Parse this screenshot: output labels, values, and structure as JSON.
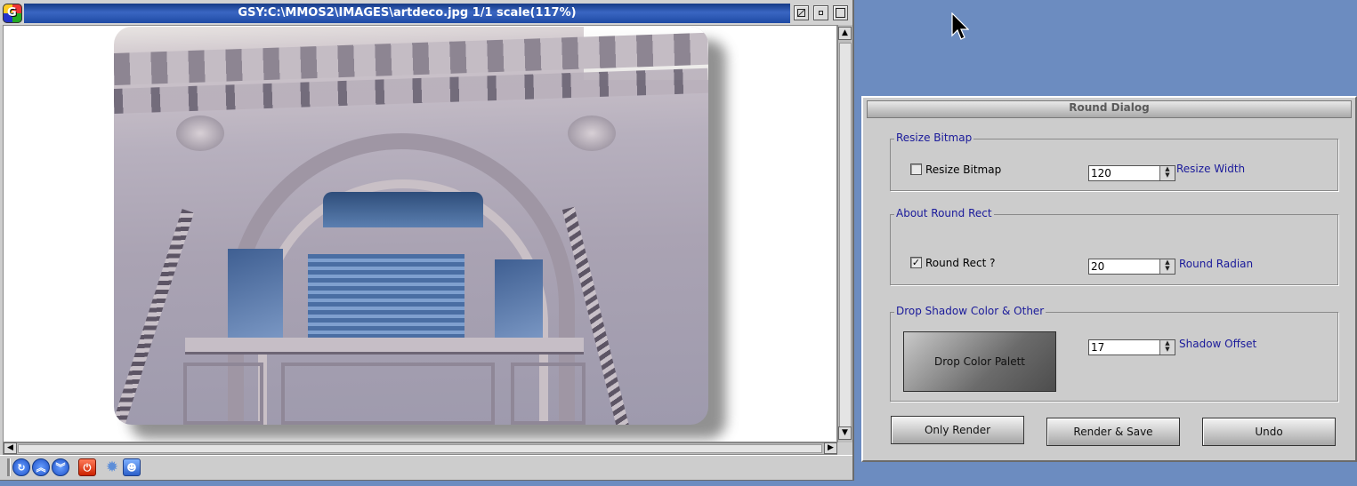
{
  "viewer": {
    "title": "GSY:C:\\MMOS2\\IMAGES\\artdeco.jpg   1/1 scale(117%)",
    "app_icon_letter": "G",
    "statusbar_icons": [
      "back-icon",
      "scroll-up-icon",
      "scroll-down-icon",
      "power-icon",
      "gear-icon",
      "agent-icon"
    ]
  },
  "dialog": {
    "title": "Round Dialog",
    "resize_group": {
      "label": "Resize Bitmap",
      "checkbox_label": "Resize Bitmap",
      "checked": false,
      "value": "120",
      "field_label": "Resize Width"
    },
    "round_group": {
      "label": "About Round Rect",
      "checkbox_label": "Round Rect ?",
      "checked": true,
      "value": "20",
      "field_label": "Round Radian"
    },
    "shadow_group": {
      "label": "Drop Shadow Color  & Other",
      "palette_label": "Drop Color Palett",
      "value": "17",
      "field_label": "Shadow Offset"
    },
    "buttons": {
      "only_render": "Only Render",
      "render_save": "Render & Save",
      "undo": "Undo"
    }
  },
  "colors": {
    "desktop": "#6c8cc0",
    "title_active": "#2a55ac",
    "label_blue": "#1a1a9a"
  }
}
